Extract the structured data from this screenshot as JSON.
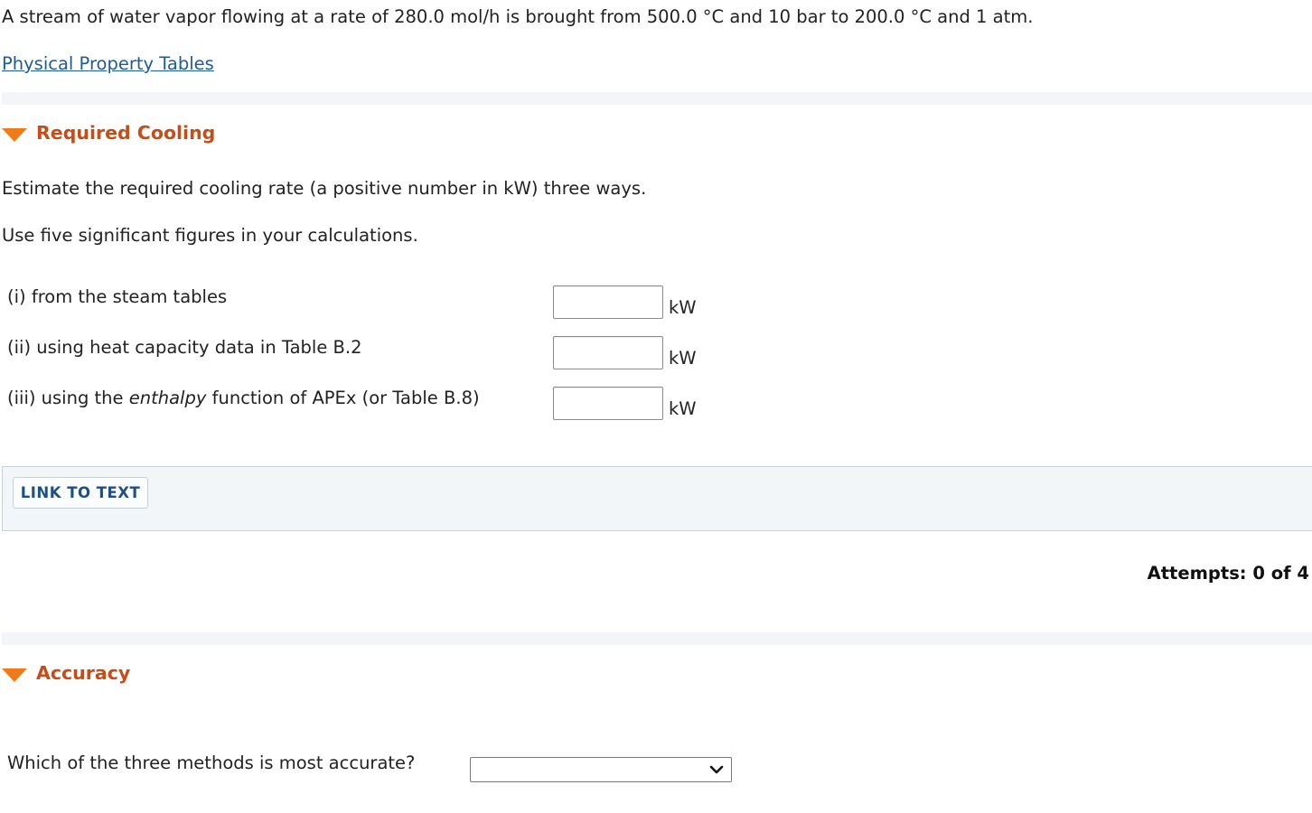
{
  "problem": {
    "statement": "A stream of water vapor flowing at a rate of 280.0 mol/h is brought from 500.0 °C and 10 bar to 200.0 °C and 1 atm.",
    "link_label": "Physical Property Tables"
  },
  "required_cooling": {
    "title": "Required Cooling",
    "instruction_1": "Estimate the required cooling rate (a positive number in kW) three ways.",
    "instruction_2": "Use five significant figures in your calculations.",
    "questions": [
      {
        "label": "(i) from the steam tables",
        "value": "",
        "unit": "kW"
      },
      {
        "label_prefix": "(ii) using heat capacity data in Table B.2",
        "value": "",
        "unit": "kW"
      },
      {
        "label_prefix": "(iii) using the ",
        "label_em": "enthalpy",
        "label_suffix": " function of APEx (or Table B.8)",
        "value": "",
        "unit": "kW"
      }
    ],
    "link_to_text_label": "LINK TO TEXT",
    "attempts": "Attempts: 0 of 4"
  },
  "accuracy": {
    "title": "Accuracy",
    "question": "Which of the three methods is most accurate?",
    "selected_value": ""
  },
  "colors": {
    "section_title": "#c84c15",
    "caret": "#f07b16",
    "link": "#1d5c9a",
    "link_button_text": "#1d4f86",
    "panel_background": "#f3f6f9"
  },
  "icons": {
    "section_toggle": "caret-down-icon",
    "select_arrow": "chevron-down-icon"
  }
}
